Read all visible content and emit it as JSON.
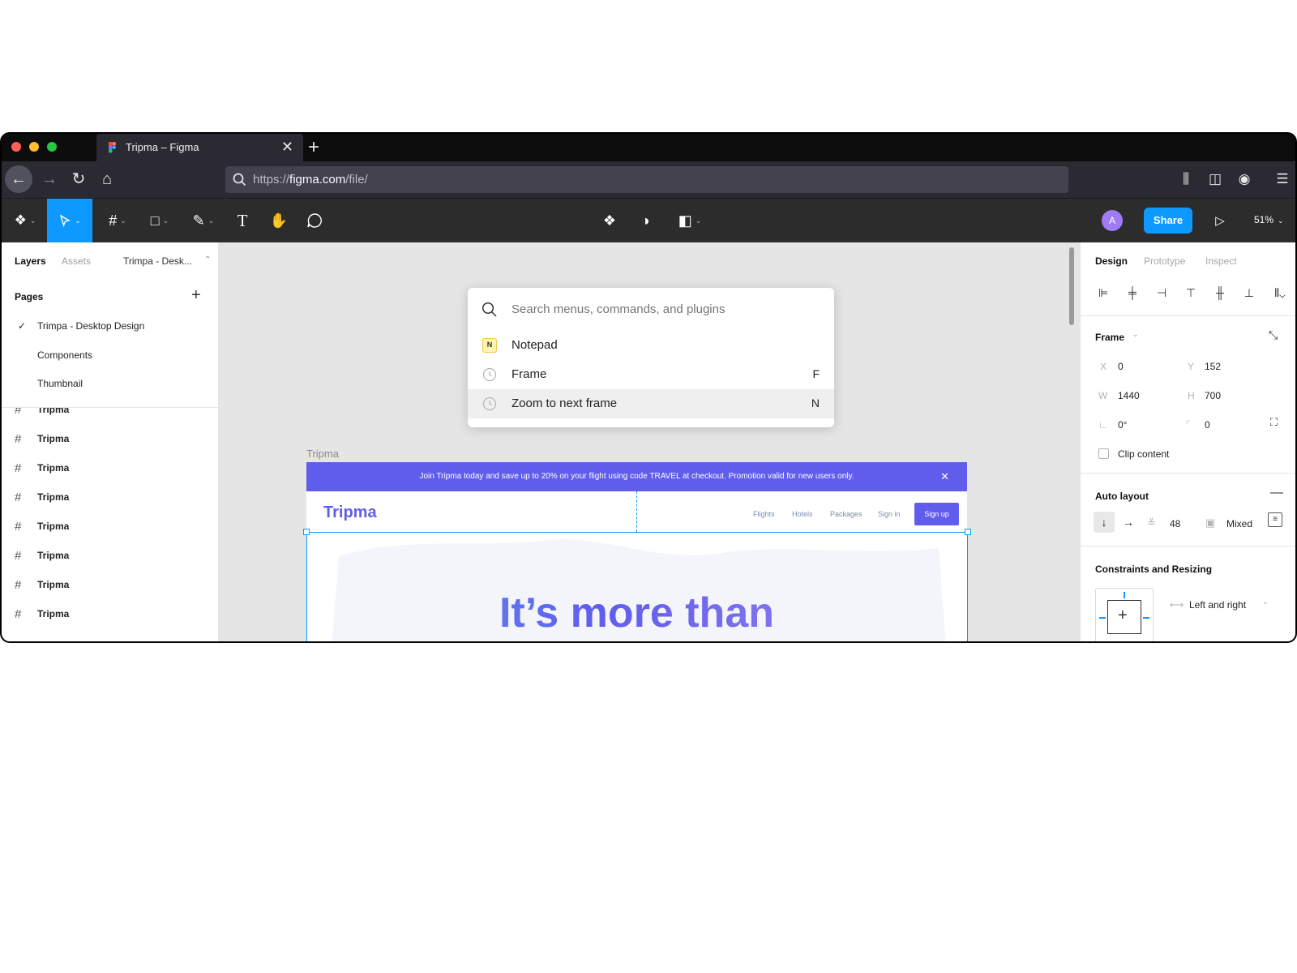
{
  "browser": {
    "tab_title": "Tripma – Figma",
    "url_prefix": "https://",
    "url_host": "figma.com",
    "url_path": "/file/"
  },
  "toolbar": {
    "avatar_letter": "A",
    "share_label": "Share",
    "zoom_label": "51%"
  },
  "left_panel": {
    "tabs": [
      "Layers",
      "Assets"
    ],
    "file_name": "Trimpa - Desk...",
    "pages_title": "Pages",
    "pages": [
      {
        "label": "Trimpa - Desktop Design",
        "selected": true
      },
      {
        "label": "Components",
        "selected": false
      },
      {
        "label": "Thumbnail",
        "selected": false
      }
    ],
    "layers": [
      "Tripma",
      "Tripma",
      "Tripma",
      "Tripma",
      "Tripma",
      "Tripma",
      "Tripma",
      "Tripma"
    ]
  },
  "palette": {
    "placeholder": "Search menus, commands, and plugins",
    "items": [
      {
        "label": "Notepad",
        "shortcut": "",
        "icon": "notepad-plugin-icon"
      },
      {
        "label": "Frame",
        "shortcut": "F",
        "icon": "recent-clock-icon"
      },
      {
        "label": "Zoom to next frame",
        "shortcut": "N",
        "icon": "recent-clock-icon"
      }
    ]
  },
  "frame": {
    "label": "Tripma",
    "promo_text": "Join Tripma today and save up to 20% on your flight using code TRAVEL at checkout. Promotion valid for new users only.",
    "logo": "Tripma",
    "nav": [
      "Flights",
      "Hotels",
      "Packages",
      "Sign in"
    ],
    "signup": "Sign up",
    "hero": "It’s more than"
  },
  "right_panel": {
    "tabs": [
      "Design",
      "Prototype",
      "Inspect"
    ],
    "frame_title": "Frame",
    "x_label": "X",
    "x": "0",
    "y_label": "Y",
    "y": "152",
    "w_label": "W",
    "w": "1440",
    "h_label": "H",
    "h": "700",
    "rotation": "0°",
    "radius": "0",
    "clip_content": "Clip content",
    "auto_layout_title": "Auto layout",
    "spacing": "48",
    "padding": "Mixed",
    "constraints_title": "Constraints and Resizing",
    "horizontal_constraint": "Left and right"
  },
  "colors": {
    "accent": "#0d99ff",
    "brand": "#605dec"
  }
}
